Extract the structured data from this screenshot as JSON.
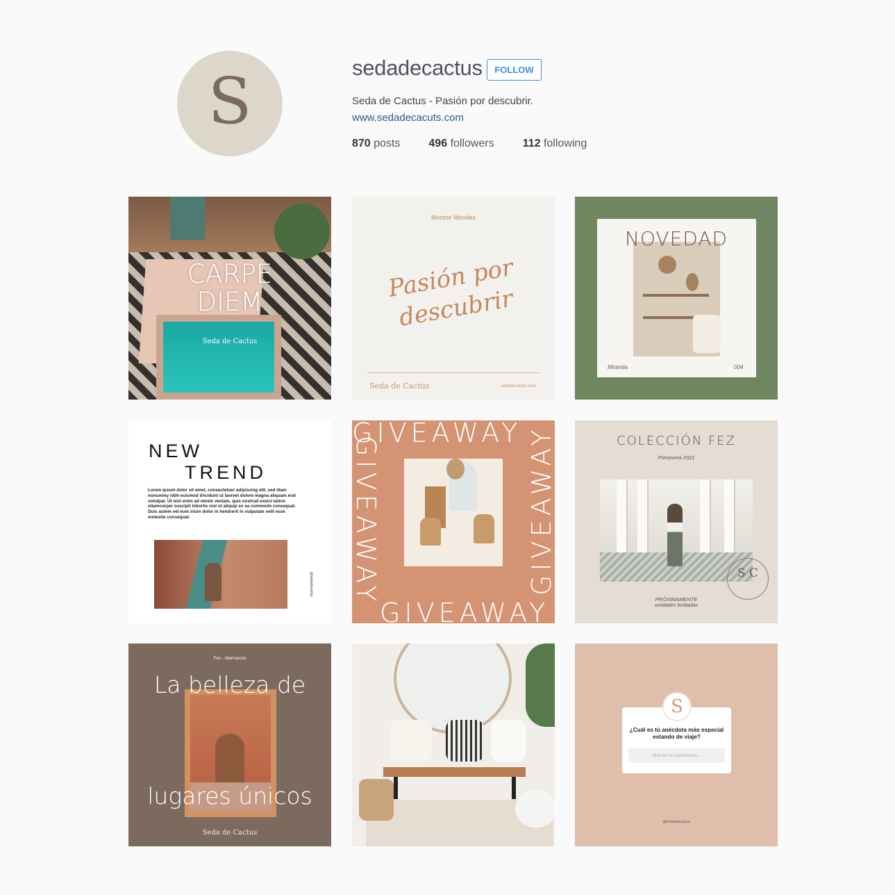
{
  "profile": {
    "avatar_letter": "S",
    "username": "sedadecactus",
    "follow_label": "FOLLOW",
    "bio": "Seda de Cactus - Pasión por descubrir.",
    "website": "www.sedadecacuts.com",
    "stats": {
      "posts_count": "870",
      "posts_label": "posts",
      "followers_count": "496",
      "followers_label": "followers",
      "following_count": "112",
      "following_label": "following"
    }
  },
  "colors": {
    "accent_blue": "#3d8ee0",
    "avatar_bg": "#ddd6cb"
  },
  "posts": [
    {
      "lines": [
        "CARPE",
        "DIEM"
      ],
      "brand": "Seda de Cactus"
    },
    {
      "author": "Montse Morales",
      "script_lines": [
        "Pasión por",
        "descubrir"
      ],
      "brand": "Seda de Cactus",
      "url": "sedadecactus.com"
    },
    {
      "title": "NOVEDAD",
      "label_left": "Miranda",
      "label_right": "004"
    },
    {
      "line1": "NEW",
      "line2": "TREND",
      "body": "Lorem ipsum dolor sit amet, consectetuer adipiscing elit, sed diam nonummy nibh euismod tincidunt ut laoreet dolore magna aliquam erat volutpat. Ut wisi enim ad minim veniam, quis nostrud exerci tation ullamcorper suscipit lobortis nisl ut aliquip ex ea commodo consequat. Duis autem vel eum iriure dolor in hendrerit in vulputate velit esse molestie consequat.",
      "handle": "@sedadecactus"
    },
    {
      "word": "GIVEAWAY"
    },
    {
      "title": "COLECCIÓN FEZ",
      "subtitle": "Primavera 2021",
      "seal_letters": "S C",
      "line1": "PRÓXIMAMENTE",
      "line2": "unidades limitadas"
    },
    {
      "location": "Fez - Marruecos",
      "line1": "La belleza de",
      "line2": "lugares únicos",
      "brand": "Seda de Cactus"
    },
    {},
    {
      "badge_letter": "S",
      "question": "¿Cuál es tú anécdota más especial estando de viaje?",
      "input_placeholder": "dime en los comentarios...",
      "handle": "@sedadecactus"
    }
  ]
}
